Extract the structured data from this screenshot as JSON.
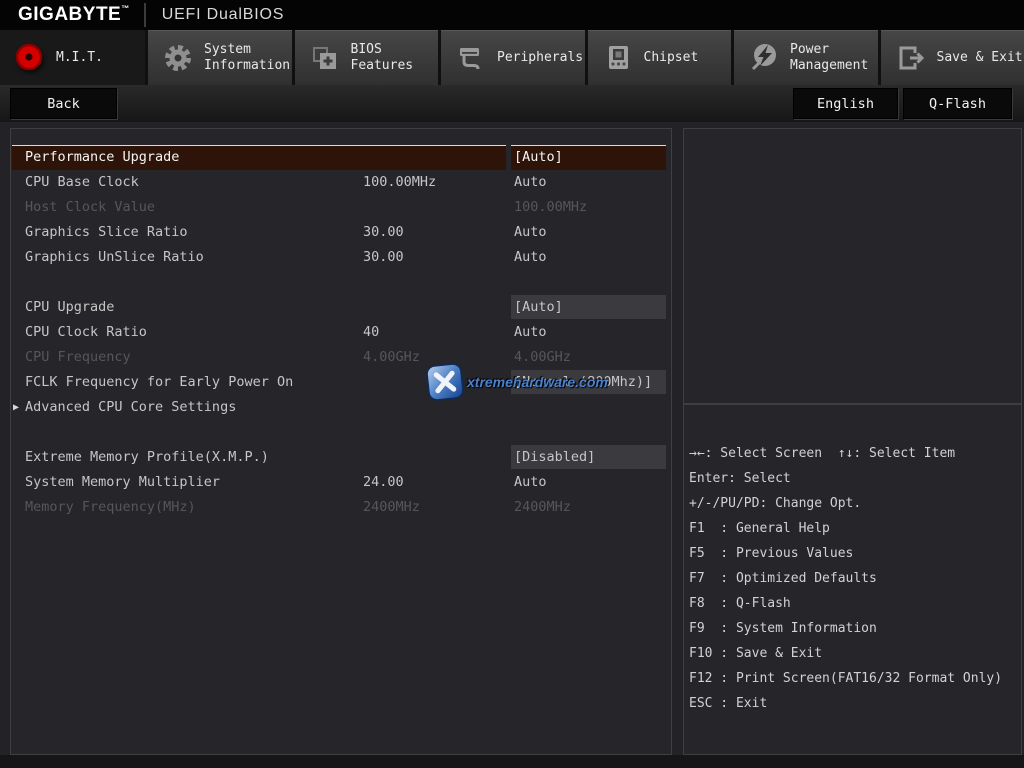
{
  "header": {
    "brand": "GIGABYTE",
    "trademark": "™",
    "title": "UEFI DualBIOS"
  },
  "tabs": [
    {
      "id": "mit",
      "label": "M.I.T.",
      "icon": "record-icon",
      "active": true
    },
    {
      "id": "system-information",
      "label": "System\nInformation",
      "icon": "gear-icon",
      "active": false
    },
    {
      "id": "bios-features",
      "label": "BIOS\nFeatures",
      "icon": "folders-icon",
      "active": false
    },
    {
      "id": "peripherals",
      "label": "Peripherals",
      "icon": "peripheral-icon",
      "active": false
    },
    {
      "id": "chipset",
      "label": "Chipset",
      "icon": "chip-icon",
      "active": false
    },
    {
      "id": "power-management",
      "label": "Power\nManagement",
      "icon": "lightning-icon",
      "active": false
    },
    {
      "id": "save-exit",
      "label": "Save & Exit",
      "icon": "exit-icon",
      "active": false
    }
  ],
  "toolbar": {
    "back": "Back",
    "language": "English",
    "qflash": "Q-Flash"
  },
  "settings_sections": [
    {
      "rows": [
        {
          "label": "Performance Upgrade",
          "current": "",
          "value": "[Auto]",
          "state": "selected",
          "boxed": true
        },
        {
          "label": "CPU Base Clock",
          "current": "100.00MHz",
          "value": "Auto",
          "state": "normal",
          "boxed": false
        },
        {
          "label": "Host Clock Value",
          "current": "",
          "value": "100.00MHz",
          "state": "dim",
          "boxed": false
        },
        {
          "label": "Graphics Slice Ratio",
          "current": "30.00",
          "value": "Auto",
          "state": "normal",
          "boxed": false
        },
        {
          "label": "Graphics UnSlice Ratio",
          "current": "30.00",
          "value": "Auto",
          "state": "normal",
          "boxed": false
        }
      ]
    },
    {
      "rows": [
        {
          "label": "CPU Upgrade",
          "current": "",
          "value": "[Auto]",
          "state": "normal",
          "boxed": true
        },
        {
          "label": "CPU Clock Ratio",
          "current": "40",
          "value": "Auto",
          "state": "normal",
          "boxed": false
        },
        {
          "label": "CPU Frequency",
          "current": "4.00GHz",
          "value": "4.00GHz",
          "state": "dim",
          "boxed": false
        },
        {
          "label": "FCLK Frequency for Early Power On",
          "current": "",
          "value": "[Normal (800Mhz)]",
          "state": "normal",
          "boxed": true
        },
        {
          "label": "Advanced CPU Core Settings",
          "current": "",
          "value": "",
          "state": "normal",
          "boxed": false,
          "expandable": true
        }
      ]
    },
    {
      "rows": [
        {
          "label": "Extreme Memory Profile(X.M.P.)",
          "current": "",
          "value": "[Disabled]",
          "state": "normal",
          "boxed": true
        },
        {
          "label": "System Memory Multiplier",
          "current": "24.00",
          "value": "Auto",
          "state": "normal",
          "boxed": false
        },
        {
          "label": "Memory Frequency(MHz)",
          "current": "2400MHz",
          "value": "2400MHz",
          "state": "dim",
          "boxed": false
        }
      ]
    }
  ],
  "expand_arrow": "▶",
  "help_panel": {
    "lines": [
      "→←: Select Screen  ↑↓: Select Item",
      "Enter: Select",
      "+/-/PU/PD: Change Opt.",
      "F1  : General Help",
      "F5  : Previous Values",
      "F7  : Optimized Defaults",
      "F8  : Q-Flash",
      "F9  : System Information",
      "F10 : Save & Exit",
      "F12 : Print Screen(FAT16/32 Format Only)",
      "ESC : Exit"
    ]
  },
  "watermark": {
    "text": "xtremehardware.com"
  },
  "colors": {
    "accent_red": "#d40000",
    "selected_row_bg": "#2e1309",
    "value_box_bg": "#3a3a3f",
    "tab_inactive_top": "#464646",
    "tab_inactive_bottom": "#303030"
  }
}
